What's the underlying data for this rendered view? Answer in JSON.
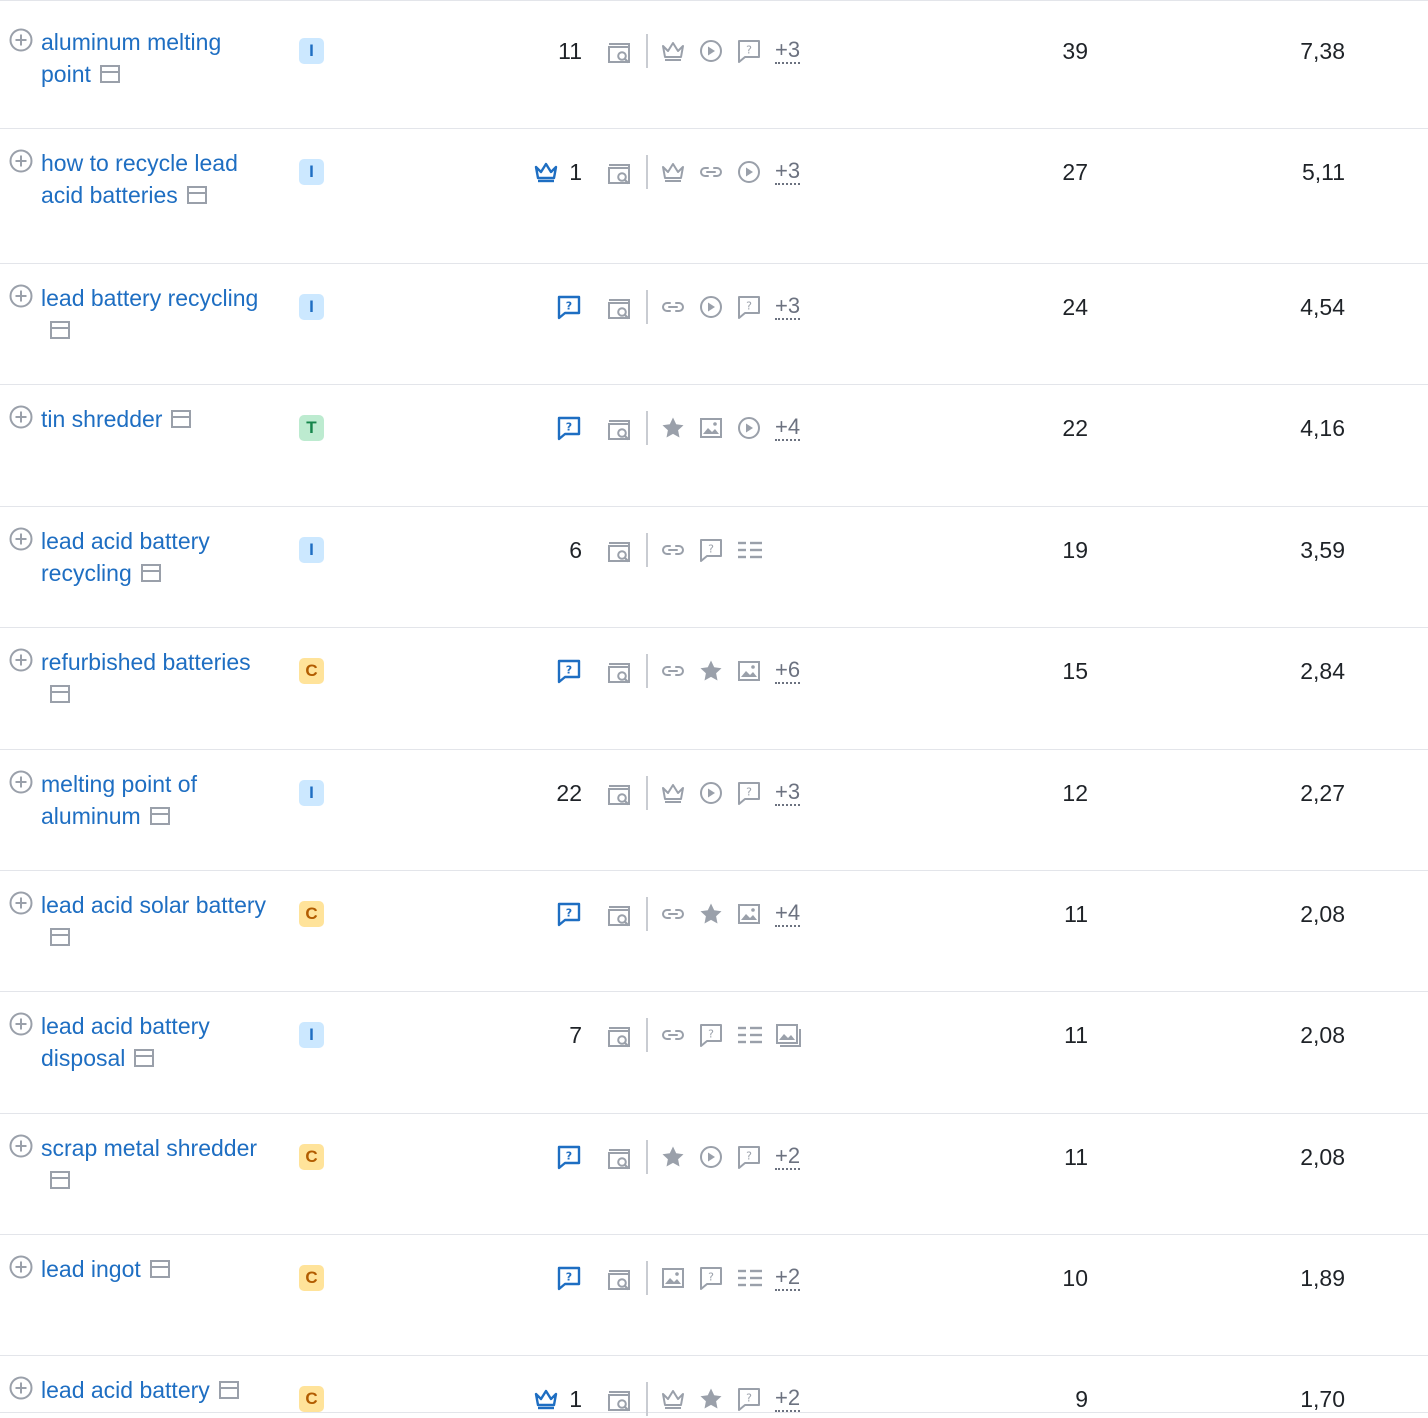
{
  "rows": [
    {
      "keyword": "aluminum melting point",
      "intent": "I",
      "position": "11",
      "crown": false,
      "question": false,
      "features": [
        "crown-outline-icon",
        "video-icon",
        "question-icon"
      ],
      "more": "+3",
      "metric_1": "39",
      "metric_2": "7,38"
    },
    {
      "keyword": "how to recycle lead acid batteries",
      "intent": "I",
      "position": "1",
      "crown": true,
      "question": false,
      "features": [
        "crown-outline-icon",
        "link-icon",
        "video-icon"
      ],
      "more": "+3",
      "metric_1": "27",
      "metric_2": "5,11"
    },
    {
      "keyword": "lead battery recycling",
      "intent": "I",
      "position": "",
      "crown": false,
      "question": true,
      "features": [
        "link-icon",
        "video-icon",
        "question-icon"
      ],
      "more": "+3",
      "metric_1": "24",
      "metric_2": "4,54"
    },
    {
      "keyword": "tin shredder",
      "intent": "T",
      "position": "",
      "crown": false,
      "question": true,
      "features": [
        "star-icon",
        "image-icon",
        "video-icon"
      ],
      "more": "+4",
      "metric_1": "22",
      "metric_2": "4,16"
    },
    {
      "keyword": "lead acid battery recycling",
      "intent": "I",
      "position": "6",
      "crown": false,
      "question": false,
      "features": [
        "link-icon",
        "question-icon",
        "list-icon"
      ],
      "more": "",
      "metric_1": "19",
      "metric_2": "3,59"
    },
    {
      "keyword": "refurbished batteries",
      "intent": "C",
      "position": "",
      "crown": false,
      "question": true,
      "features": [
        "link-icon",
        "star-icon",
        "image-icon"
      ],
      "more": "+6",
      "metric_1": "15",
      "metric_2": "2,84"
    },
    {
      "keyword": "melting point of aluminum",
      "intent": "I",
      "position": "22",
      "crown": false,
      "question": false,
      "features": [
        "crown-outline-icon",
        "video-icon",
        "question-icon"
      ],
      "more": "+3",
      "metric_1": "12",
      "metric_2": "2,27"
    },
    {
      "keyword": "lead acid solar battery",
      "intent": "C",
      "position": "",
      "crown": false,
      "question": true,
      "features": [
        "link-icon",
        "star-icon",
        "image-icon"
      ],
      "more": "+4",
      "metric_1": "11",
      "metric_2": "2,08"
    },
    {
      "keyword": "lead acid battery disposal",
      "intent": "I",
      "position": "7",
      "crown": false,
      "question": false,
      "features": [
        "link-icon",
        "question-icon",
        "list-icon",
        "image-stack-icon"
      ],
      "more": "",
      "metric_1": "11",
      "metric_2": "2,08"
    },
    {
      "keyword": "scrap metal shredder",
      "intent": "C",
      "position": "",
      "crown": false,
      "question": true,
      "features": [
        "star-icon",
        "video-icon",
        "question-icon"
      ],
      "more": "+2",
      "metric_1": "11",
      "metric_2": "2,08"
    },
    {
      "keyword": "lead ingot",
      "intent": "C",
      "position": "",
      "crown": false,
      "question": true,
      "features": [
        "image-icon",
        "question-icon",
        "list-icon"
      ],
      "more": "+2",
      "metric_1": "10",
      "metric_2": "1,89"
    },
    {
      "keyword": "lead acid battery",
      "intent": "C",
      "position": "1",
      "crown": true,
      "question": false,
      "features": [
        "crown-outline-icon",
        "star-icon",
        "question-icon"
      ],
      "more": "+2",
      "metric_1": "9",
      "metric_2": "1,70"
    }
  ],
  "colors": {
    "link": "#1e6ec2",
    "icon_gray": "#9aa0aa",
    "border": "#e3e5ea"
  }
}
